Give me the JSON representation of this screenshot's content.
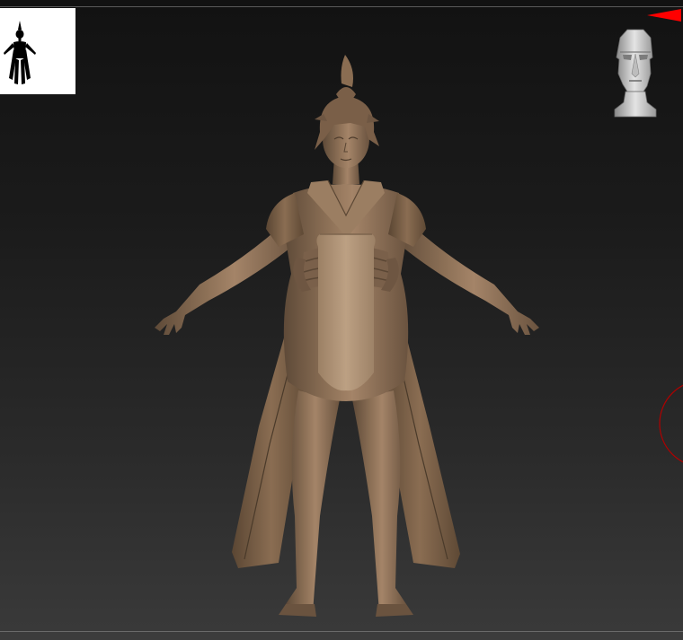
{
  "app": {
    "window_title": ""
  },
  "viewport": {
    "background_top": "#121212",
    "background_bottom": "#3a3a3a",
    "model_color": "#8c7056",
    "model_highlight": "#a98a6c",
    "model_shadow": "#5e4a38",
    "apron_color": "#b3977a"
  },
  "widgets": {
    "thumbnail_icon": "silhouette-thumbnail-icon",
    "navcube_icon": "head-navigation-icon",
    "axis_indicator_icon": "red-arrow-icon",
    "rotation_gizmo_icon": "rotation-circle-icon",
    "accent_red": "#ff0000"
  }
}
